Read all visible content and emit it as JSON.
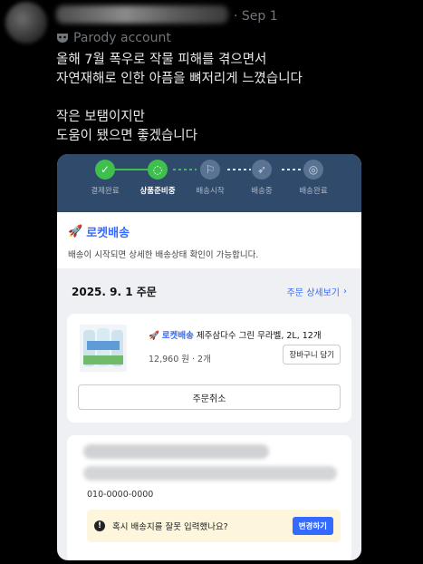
{
  "tweet": {
    "date": "· Sep 1",
    "badge": "Parody account",
    "lines": [
      "올해 7월 폭우로 작물 피해를 겪으면서",
      "자연재해로 인한 아픔을 뼈저리게 느꼈습니다",
      "작은 보탬이지만",
      "도움이 됐으면 좋겠습니다"
    ]
  },
  "app": {
    "steps": [
      {
        "label": "결제완료",
        "icon": "check-icon"
      },
      {
        "label": "상품준비중",
        "icon": "spinner-icon"
      },
      {
        "label": "배송시작",
        "icon": "flag-icon"
      },
      {
        "label": "배송중",
        "icon": "rocket-icon"
      },
      {
        "label": "배송완료",
        "icon": "bulb-icon"
      }
    ],
    "rocket": {
      "title": "로켓배송",
      "desc": "배송이 시작되면 상세한 배송상태 확인이 가능합니다."
    },
    "order": {
      "date": "2025. 9. 1 주문",
      "detail_link": "주문 상세보기"
    },
    "item": {
      "tag": "로켓배송",
      "name": "제주삼다수 그린 무라벨, 2L, 12개",
      "price": "12,960 원 · 2개",
      "cart_button": "장바구니 담기",
      "cancel_button": "주문취소"
    },
    "address": {
      "phone": "010-0000-0000",
      "warning": "혹시 배송지를 잘못 입력했나요?",
      "change_button": "변경하기"
    },
    "colors": {
      "header_bg": "#2f4a6b",
      "done_green": "#3fbf4e",
      "accent_blue": "#346aff"
    }
  }
}
